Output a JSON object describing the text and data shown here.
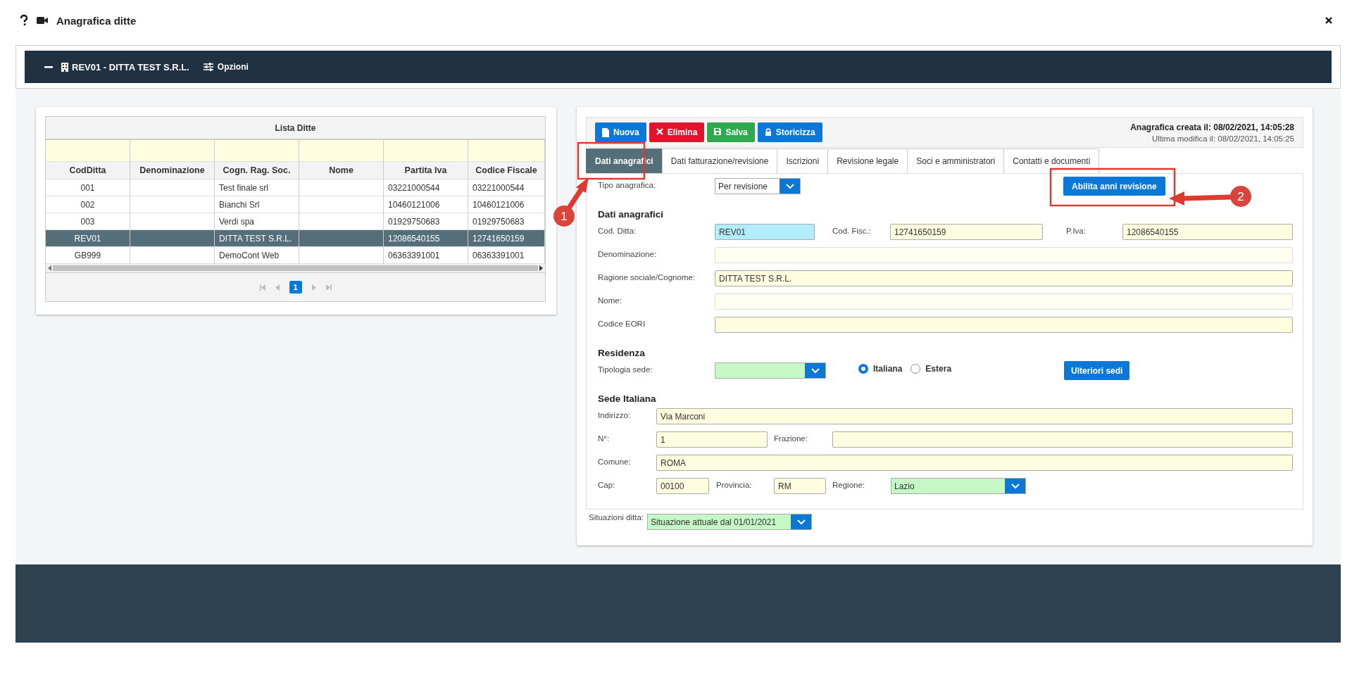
{
  "window": {
    "title": "Anagrafica ditte"
  },
  "panel_bar": {
    "title": "REV01 - DITTA TEST S.R.L.",
    "options": "Opzioni"
  },
  "company_list": {
    "title": "Lista Ditte",
    "columns": [
      "CodDitta",
      "Denominazione",
      "Cogn. Rag. Soc.",
      "Nome",
      "Partita Iva",
      "Codice Fiscale"
    ],
    "rows": [
      {
        "cells": [
          "001",
          null,
          "Test finale srl",
          null,
          "03221000544",
          "03221000544"
        ],
        "selected": false
      },
      {
        "cells": [
          "002",
          null,
          "Bianchi Srl",
          null,
          "10460121006",
          "10460121006"
        ],
        "selected": false
      },
      {
        "cells": [
          "003",
          null,
          "Verdi spa",
          null,
          "01929750683",
          "01929750683"
        ],
        "selected": false
      },
      {
        "cells": [
          "REV01",
          null,
          "DITTA TEST S.R.L.",
          null,
          "12086540155",
          "12741650159"
        ],
        "selected": true
      },
      {
        "cells": [
          "GB999",
          null,
          "DemoCont Web",
          null,
          "06363391001",
          "06363391001"
        ],
        "selected": false
      }
    ],
    "pager": {
      "pages": [
        {
          "label": "1",
          "selected": true
        }
      ]
    }
  },
  "record": {
    "toolbar": [
      {
        "label": "Nuova",
        "kind": "new"
      },
      {
        "label": "Elimina",
        "kind": "delete"
      },
      {
        "label": "Salva",
        "kind": "save"
      },
      {
        "label": "Storicizza",
        "kind": "archive"
      }
    ],
    "created": "Anagrafica creata il: 08/02/2021, 14:05:28",
    "modified": "Ultima modifica il: 08/02/2021, 14:05:25",
    "tabs": [
      {
        "label": "Dati anagrafici",
        "selected": true
      },
      {
        "label": "Dati fatturazione/revisione",
        "selected": false
      },
      {
        "label": "Iscrizioni",
        "selected": false
      },
      {
        "label": "Revisione legale",
        "selected": false
      },
      {
        "label": "Soci e amministratori",
        "selected": false
      },
      {
        "label": "Contatti e documenti",
        "selected": false
      }
    ],
    "tipo_anagrafica": {
      "label": "Tipo anagrafica:",
      "value": "Per revisione",
      "kind": "plain"
    },
    "enable_years_button": "Abilita anni revisione",
    "dati_anagrafici": {
      "heading": "Dati anagrafici",
      "cod_ditta": {
        "label": "Cod. Ditta:",
        "value": "REV01",
        "kind": "key"
      },
      "cod_fisc": {
        "label": "Cod. Fisc.:",
        "value": "12741650159",
        "kind": "required"
      },
      "p_iva": {
        "label": "P.Iva:",
        "value": "12086540155",
        "kind": "required"
      },
      "denominazione": {
        "label": "Denominazione:",
        "kind": "optional"
      },
      "ragione_sociale": {
        "label": "Ragione sociale/Cognome:",
        "value": "DITTA TEST S.R.L.",
        "kind": "required"
      },
      "nome": {
        "label": "Nome:",
        "kind": "optional"
      },
      "codice_eori": {
        "label": "Codice EORI",
        "kind": "required"
      }
    },
    "residenza": {
      "heading": "Residenza",
      "tipologia_sede": {
        "label": "Tipologia sede:",
        "kind": "choice"
      },
      "location": [
        {
          "label": "Italiana",
          "selected": true
        },
        {
          "label": "Estera",
          "selected": false
        }
      ],
      "more_sites_button": "Ulteriori sedi"
    },
    "sede_italiana": {
      "heading": "Sede Italiana",
      "indirizzo": {
        "label": "Indirizzo:",
        "value": "Via Marconi",
        "kind": "required"
      },
      "numero": {
        "label": "N°:",
        "value": "1",
        "kind": "required"
      },
      "frazione": {
        "label": "Frazione:",
        "kind": "required"
      },
      "comune": {
        "label": "Comune:",
        "value": "ROMA",
        "kind": "required"
      },
      "cap": {
        "label": "Cap:",
        "value": "00100",
        "kind": "required"
      },
      "provincia": {
        "label": "Provincia:",
        "value": "RM",
        "kind": "required"
      },
      "regione": {
        "label": "Regione:",
        "value": "Lazio",
        "kind": "choice"
      }
    },
    "situazioni": {
      "label": "Situazioni ditta:",
      "value": "Situazione attuale dal 01/01/2021",
      "kind": "choice"
    }
  },
  "annotations": [
    {
      "number": "1"
    },
    {
      "number": "2"
    }
  ]
}
